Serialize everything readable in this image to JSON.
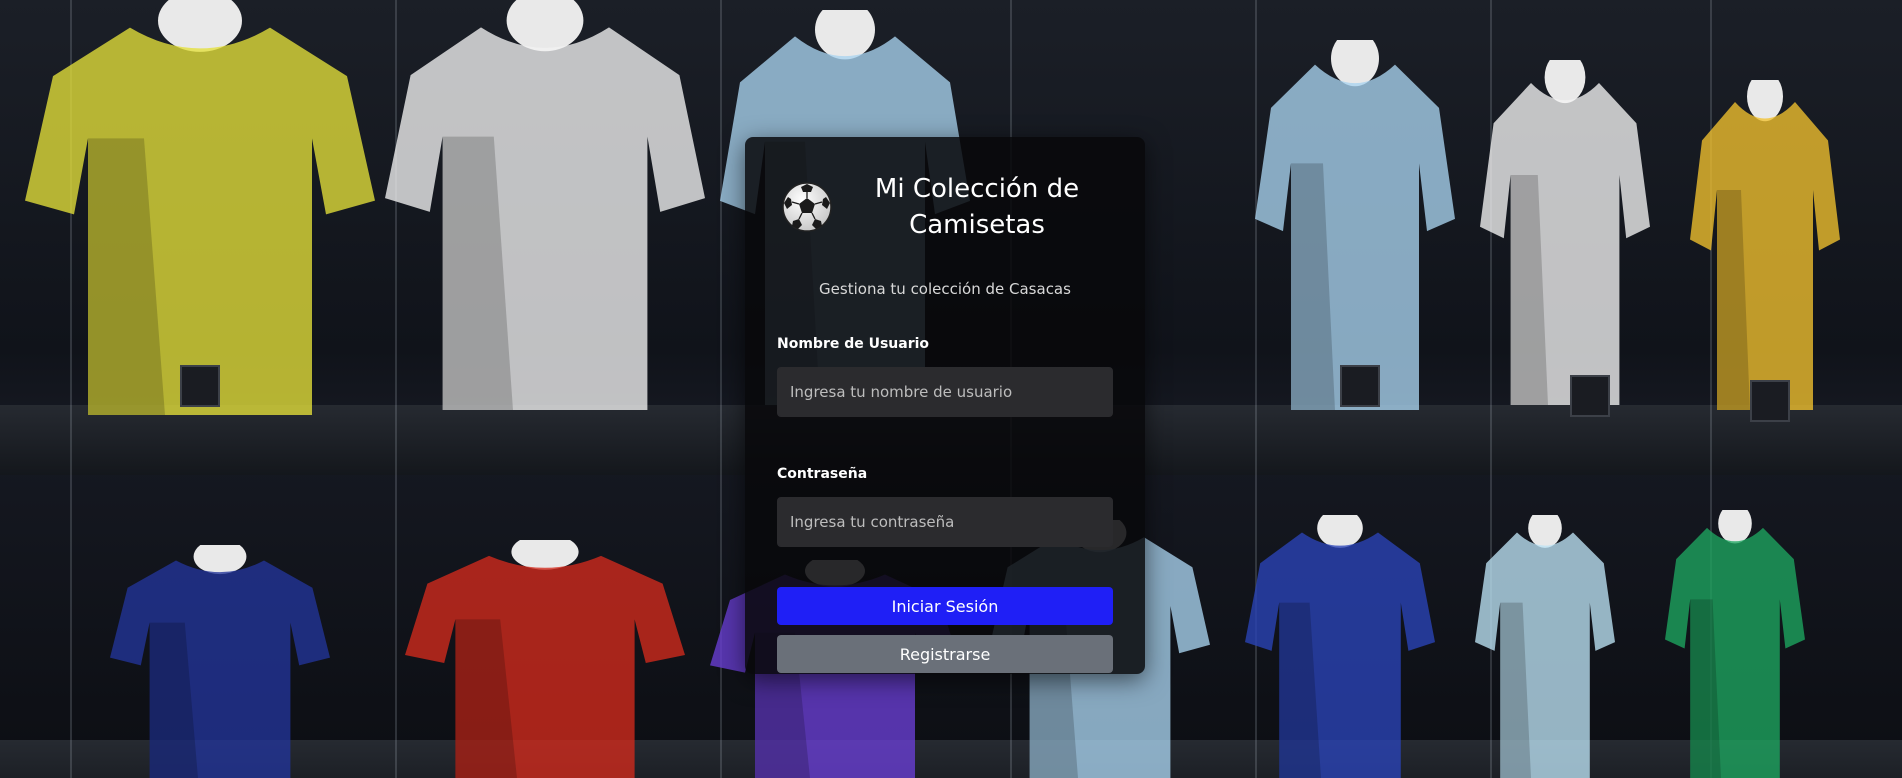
{
  "login": {
    "app_icon": "soccer-ball-icon",
    "title": "Mi Colección de Camisetas",
    "subtitle": "Gestiona tu colección de Casacas",
    "username": {
      "label": "Nombre de Usuario",
      "placeholder": "Ingresa tu nombre de usuario",
      "value": ""
    },
    "password": {
      "label": "Contraseña",
      "placeholder": "Ingresa tu contraseña",
      "value": ""
    },
    "login_button": "Iniciar Sesión",
    "register_button": "Registrarse"
  },
  "colors": {
    "login_button": "#1f1ff6",
    "register_button": "#6a7079",
    "card_background": "#08080a",
    "input_background": "#2b2b2e"
  },
  "background": {
    "description_icon": "jersey-showcase-background",
    "jersey_colors": [
      "#e4e03a",
      "#f2f2f2",
      "#a9d3f0",
      "#a9d3f0",
      "#f4f4f4",
      "#f2c22e",
      "#23349a",
      "#d42a1c",
      "#6a3fd6",
      "#a9d3f0",
      "#2a44b8",
      "#bde3f5",
      "#1ea760"
    ]
  }
}
